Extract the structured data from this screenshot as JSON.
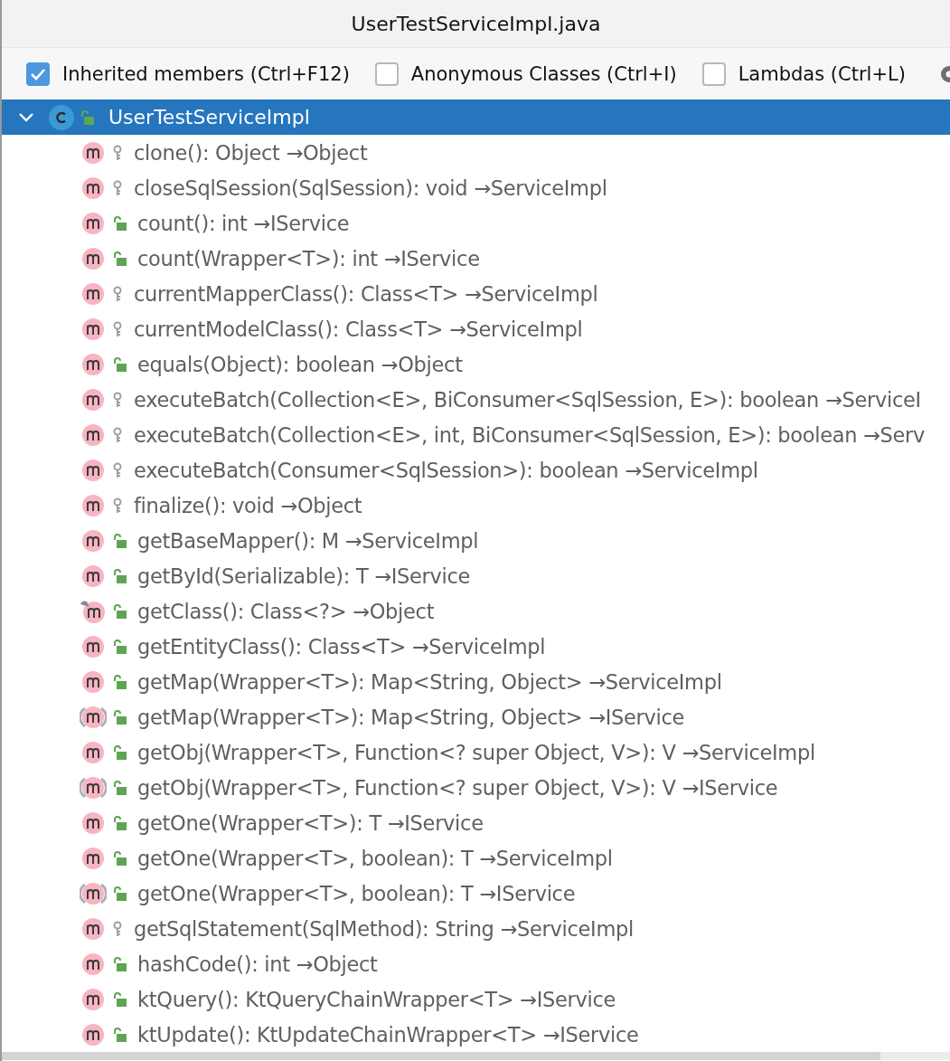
{
  "window": {
    "title": "UserTestServiceImpl.java"
  },
  "filters": [
    {
      "label": "Inherited members (Ctrl+F12)",
      "checked": true
    },
    {
      "label": "Anonymous Classes (Ctrl+I)",
      "checked": false
    },
    {
      "label": "Lambdas (Ctrl+L)",
      "checked": false
    }
  ],
  "tree": {
    "root": {
      "label": "UserTestServiceImpl",
      "expanded": true,
      "selected": true,
      "protected": false,
      "children": [
        {
          "label": "clone(): Object →Object",
          "kind": "method",
          "protected": true
        },
        {
          "label": "closeSqlSession(SqlSession): void →ServiceImpl",
          "kind": "method",
          "protected": true
        },
        {
          "label": "count(): int →IService",
          "kind": "method",
          "protected": false
        },
        {
          "label": "count(Wrapper<T>): int →IService",
          "kind": "method",
          "protected": false
        },
        {
          "label": "currentMapperClass(): Class<T> →ServiceImpl",
          "kind": "method",
          "protected": true
        },
        {
          "label": "currentModelClass(): Class<T> →ServiceImpl",
          "kind": "method",
          "protected": true
        },
        {
          "label": "equals(Object): boolean →Object",
          "kind": "method",
          "protected": false
        },
        {
          "label": "executeBatch(Collection<E>, BiConsumer<SqlSession, E>): boolean →ServiceI",
          "kind": "method",
          "protected": true
        },
        {
          "label": "executeBatch(Collection<E>, int, BiConsumer<SqlSession, E>): boolean →Serv",
          "kind": "method",
          "protected": true
        },
        {
          "label": "executeBatch(Consumer<SqlSession>): boolean →ServiceImpl",
          "kind": "method",
          "protected": true
        },
        {
          "label": "finalize(): void →Object",
          "kind": "method",
          "protected": true
        },
        {
          "label": "getBaseMapper(): M →ServiceImpl",
          "kind": "method",
          "protected": false
        },
        {
          "label": "getById(Serializable): T →IService",
          "kind": "method",
          "protected": false
        },
        {
          "label": "getClass(): Class<?> →Object",
          "kind": "pinned",
          "protected": false
        },
        {
          "label": "getEntityClass(): Class<T> →ServiceImpl",
          "kind": "method",
          "protected": false
        },
        {
          "label": "getMap(Wrapper<T>): Map<String, Object> →ServiceImpl",
          "kind": "method",
          "protected": false
        },
        {
          "label": "getMap(Wrapper<T>): Map<String, Object> →IService",
          "kind": "abstract",
          "protected": false
        },
        {
          "label": "getObj(Wrapper<T>, Function<? super Object, V>): V →ServiceImpl",
          "kind": "method",
          "protected": false
        },
        {
          "label": "getObj(Wrapper<T>, Function<? super Object, V>): V →IService",
          "kind": "abstract",
          "protected": false
        },
        {
          "label": "getOne(Wrapper<T>): T →IService",
          "kind": "method",
          "protected": false
        },
        {
          "label": "getOne(Wrapper<T>, boolean): T →ServiceImpl",
          "kind": "method",
          "protected": false
        },
        {
          "label": "getOne(Wrapper<T>, boolean): T →IService",
          "kind": "abstract",
          "protected": false
        },
        {
          "label": "getSqlStatement(SqlMethod): String →ServiceImpl",
          "kind": "method",
          "protected": true
        },
        {
          "label": "hashCode(): int →Object",
          "kind": "method",
          "protected": false
        },
        {
          "label": "ktQuery(): KtQueryChainWrapper<T> →IService",
          "kind": "method",
          "protected": false
        },
        {
          "label": "ktUpdate(): KtUpdateChainWrapper<T> →IService",
          "kind": "method",
          "protected": false
        }
      ]
    }
  }
}
